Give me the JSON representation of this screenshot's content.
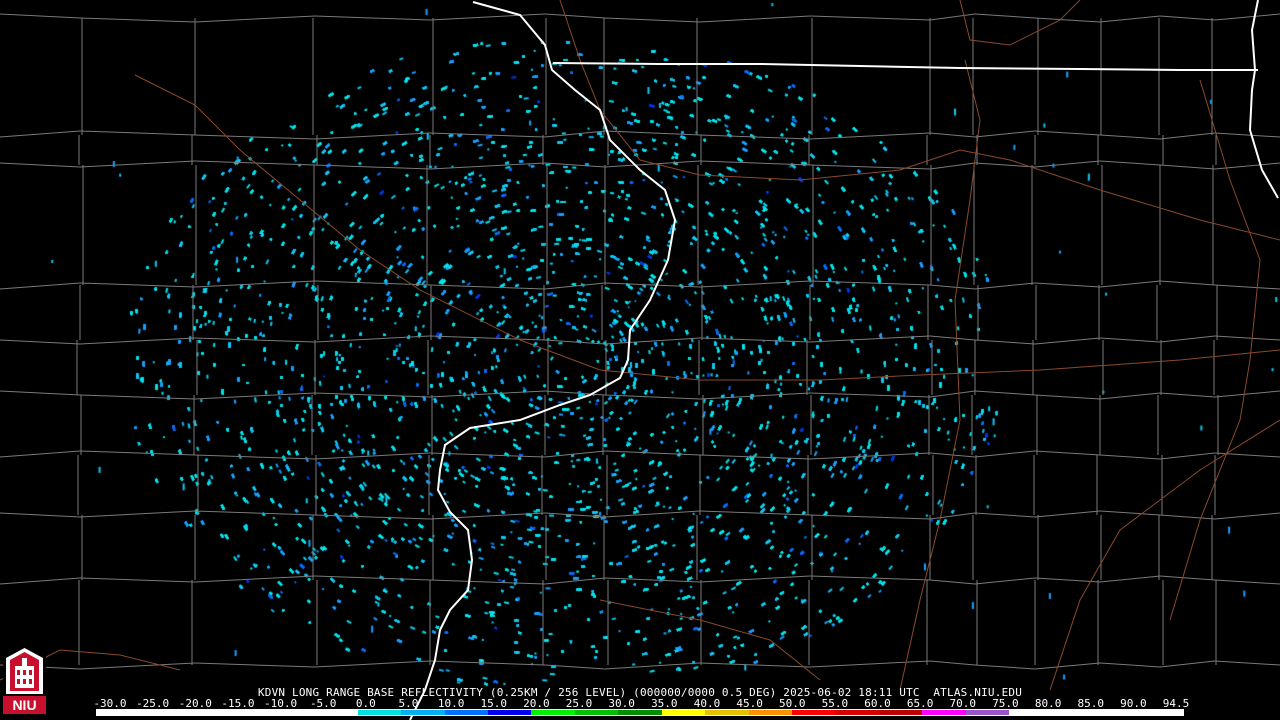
{
  "header": {
    "title_line": "KDVN LONG RANGE BASE REFLECTIVITY (0.25KM / 256 LEVEL) (000000/0000 0.5 DEG) 2025-06-02 18:11 UTC  ATLAS.NIU.EDU"
  },
  "logo": {
    "text": "NIU"
  },
  "color_scale": {
    "labels": [
      "-30.0",
      "-25.0",
      "-20.0",
      "-15.0",
      "-10.0",
      "-5.0",
      "0.0",
      "5.0",
      "10.0",
      "15.0",
      "20.0",
      "25.0",
      "30.0",
      "35.0",
      "40.0",
      "45.0",
      "50.0",
      "55.0",
      "60.0",
      "65.0",
      "70.0",
      "75.0",
      "80.0",
      "85.0",
      "90.0",
      "94.5"
    ],
    "colors": [
      "#ffffff",
      "#ffffff",
      "#ffffff",
      "#ffffff",
      "#ffffff",
      "#ffffff",
      "#00e0e0",
      "#00b0f0",
      "#0070ff",
      "#0000f0",
      "#00f000",
      "#00c000",
      "#009000",
      "#ffff00",
      "#e7c000",
      "#ff9000",
      "#ff0000",
      "#d60000",
      "#c00000",
      "#ff00ff",
      "#9955c9",
      "#ffffff",
      "#ffffff",
      "#ffffff",
      "#ffffff"
    ]
  },
  "map": {
    "radar_site": "KDVN",
    "echo_colors": [
      "#00e5ee",
      "#12c8f5",
      "#1aa0ff",
      "#0b6cf5",
      "#0038e0"
    ]
  }
}
